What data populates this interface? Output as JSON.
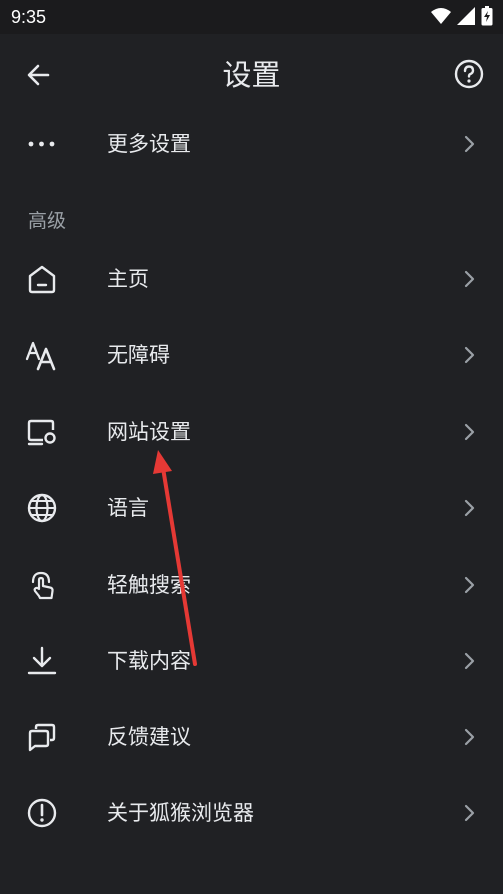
{
  "status": {
    "time": "9:35"
  },
  "app_bar": {
    "title": "设置"
  },
  "more_settings": {
    "label": "更多设置"
  },
  "section": {
    "header": "高级"
  },
  "items": [
    {
      "label": "主页",
      "icon": "home-icon"
    },
    {
      "label": "无障碍",
      "icon": "accessibility-text-icon"
    },
    {
      "label": "网站设置",
      "icon": "site-settings-icon"
    },
    {
      "label": "语言",
      "icon": "globe-icon"
    },
    {
      "label": "轻触搜索",
      "icon": "touch-icon"
    },
    {
      "label": "下载内容",
      "icon": "download-icon"
    },
    {
      "label": "反馈建议",
      "icon": "feedback-icon"
    },
    {
      "label": "关于狐猴浏览器",
      "icon": "info-icon"
    }
  ],
  "colors": {
    "background": "#202124",
    "text": "#e8eaed",
    "secondary_text": "#9aa0a6",
    "annotation_arrow": "#e53935"
  }
}
